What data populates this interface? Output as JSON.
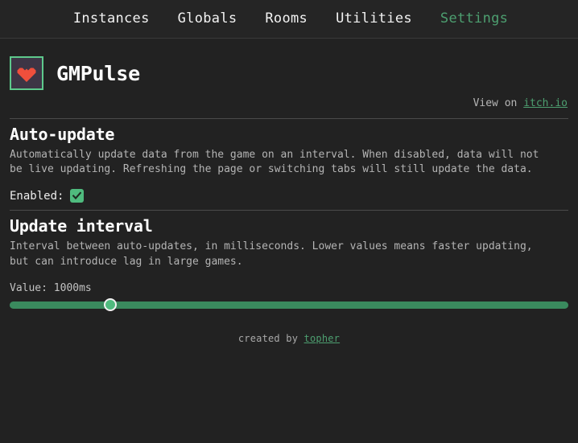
{
  "nav": {
    "items": [
      {
        "label": "Instances",
        "active": false
      },
      {
        "label": "Globals",
        "active": false
      },
      {
        "label": "Rooms",
        "active": false
      },
      {
        "label": "Utilities",
        "active": false
      },
      {
        "label": "Settings",
        "active": true
      }
    ],
    "active_color": "#4d9f70"
  },
  "brand": {
    "title": "GMPulse",
    "logo_icon": "heart-icon",
    "logo_border_color": "#5ec98c",
    "logo_bg_color": "#3d3545",
    "logo_heart_color": "#ef4f3c"
  },
  "external": {
    "prefix": "View on ",
    "link_label": "itch.io"
  },
  "sections": [
    {
      "id": "auto-update",
      "title": "Auto-update",
      "description": "Automatically update data from the game on an interval. When disabled, data will not be live updating. Refreshing the page or switching tabs will still update the data.",
      "field_label": "Enabled:",
      "checkbox_checked": "checked",
      "checkbox_color": "#4fbb7e"
    },
    {
      "id": "update-interval",
      "title": "Update interval",
      "description": "Interval between auto-updates, in milliseconds. Lower values means faster updating, but can introduce lag in large games.",
      "value_label": "Value: 1000ms",
      "slider": {
        "value": 1000,
        "display": "1000ms",
        "thumb_percent": 18,
        "track_color": "#3a8a5e",
        "thumb_color": "#4fbb7e"
      }
    }
  ],
  "footer": {
    "prefix": "created by ",
    "link_label": "topher"
  }
}
